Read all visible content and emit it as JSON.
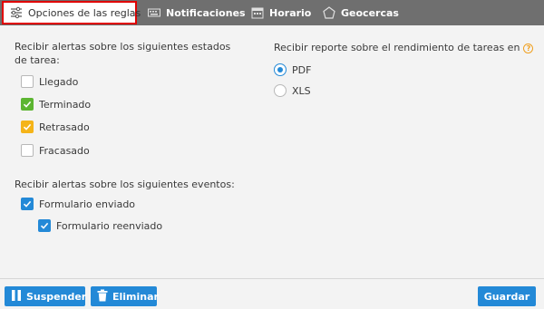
{
  "tabs": [
    {
      "label": "Opciones de las reglas",
      "icon": "sliders-icon",
      "active": true
    },
    {
      "label": "Notificaciones",
      "icon": "keyboard-icon",
      "active": false
    },
    {
      "label": "Horario",
      "icon": "calendar-icon",
      "active": false
    },
    {
      "label": "Geocercas",
      "icon": "pentagon-icon",
      "active": false
    }
  ],
  "states": {
    "heading": "Recibir alertas sobre los siguientes estados de tarea:",
    "items": [
      {
        "label": "Llegado",
        "checked": false,
        "color": "#ffffff"
      },
      {
        "label": "Terminado",
        "checked": true,
        "color": "#5cb531"
      },
      {
        "label": "Retrasado",
        "checked": true,
        "color": "#f5b418"
      },
      {
        "label": "Fracasado",
        "checked": false,
        "color": "#ffffff"
      }
    ]
  },
  "events": {
    "heading": "Recibir alertas sobre los siguientes eventos:",
    "items": [
      {
        "label": "Formulario enviado",
        "checked": true
      },
      {
        "label": "Formulario reenviado",
        "checked": true
      }
    ]
  },
  "report": {
    "heading": "Recibir reporte sobre el rendimiento de tareas en",
    "help": "?",
    "options": [
      {
        "label": "PDF",
        "selected": true
      },
      {
        "label": "XLS",
        "selected": false
      }
    ]
  },
  "footer": {
    "suspend_label": "Suspender",
    "delete_label": "Eliminar",
    "save_label": "Guardar"
  },
  "colors": {
    "accent": "#2389d7",
    "tabbar": "#6f6f6f",
    "highlight_border": "#e00000"
  }
}
